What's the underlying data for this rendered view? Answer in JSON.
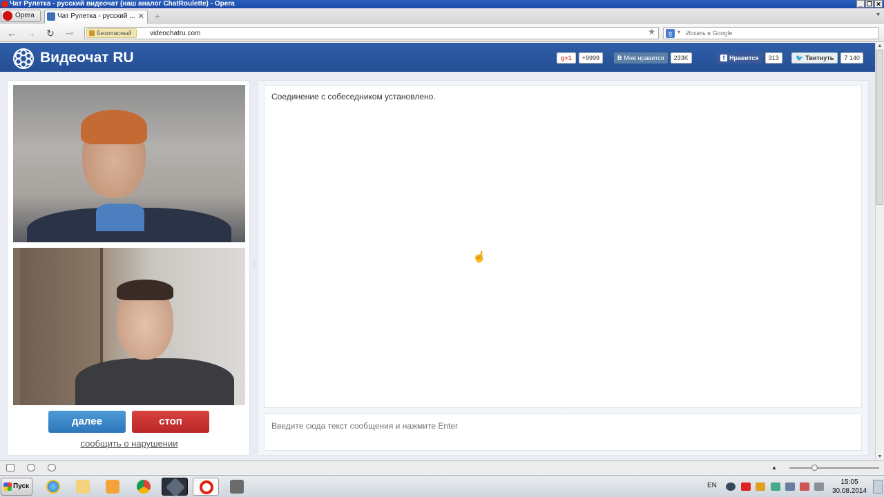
{
  "window": {
    "title": "Чат Рулетка - русский видеочат (наш аналог ChatRoulette) - Opera",
    "controls": [
      "_",
      "❐",
      "✕"
    ]
  },
  "browser": {
    "menu_label": "Opera",
    "tab_title": "Чат Рулетка - русский ...",
    "tab_close": "✕",
    "new_tab": "+",
    "tabs_menu": "▾",
    "security_label": "Безопасный",
    "url": "videochatru.com",
    "bookmark_star": "★",
    "search_engine_icon": "g",
    "search_dropdown": "▾",
    "search_placeholder": "Искать в Google",
    "nav": {
      "back": "←",
      "forward": "→",
      "reload": "↻",
      "key": "⊸"
    }
  },
  "site": {
    "logo_text": "Видеочат RU",
    "social": {
      "gplus": {
        "label": "g+1",
        "count": "+9999"
      },
      "vk": {
        "logo": "B",
        "label": "Мне нравится",
        "count": "233K"
      },
      "facebook": {
        "logo": "f",
        "label": "Нравится",
        "count": "313"
      },
      "twitter": {
        "logo": "🐦",
        "label": "Твитнуть",
        "count": "7 140"
      }
    },
    "buttons": {
      "next": "далее",
      "stop": "стоп"
    },
    "report_link": "сообщить о нарушении",
    "chat": {
      "messages": [
        "Соединение с собеседником установлено."
      ],
      "input_placeholder": "Введите сюда текст сообщения и нажмите Enter"
    }
  },
  "taskbar": {
    "start_label": "Пуск",
    "language": "EN",
    "time": "15:05",
    "date": "30.08.2014"
  },
  "colors": {
    "header_blue": "#2f5ea8",
    "next_blue": "#2e76bb",
    "stop_red": "#b92626"
  }
}
